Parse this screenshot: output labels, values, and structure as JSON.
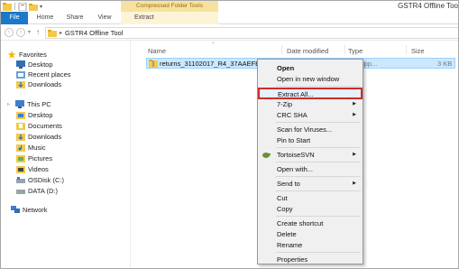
{
  "window": {
    "title": "GSTR4 Offline Too",
    "context_band": "Compressed Folder Tools"
  },
  "ribbon": {
    "tabs": [
      "File",
      "Home",
      "Share",
      "View",
      "Extract"
    ]
  },
  "address": {
    "crumb": "GSTR4 Offline Tool"
  },
  "nav": {
    "favorites": "Favorites",
    "fav_items": [
      "Desktop",
      "Recent places",
      "Downloads"
    ],
    "this_pc": "This PC",
    "pc_items": [
      "Desktop",
      "Documents",
      "Downloads",
      "Music",
      "Pictures",
      "Videos",
      "OSDisk (C:)",
      "DATA (D:)"
    ],
    "network": "Network"
  },
  "columns": {
    "name": "Name",
    "date": "Date modified",
    "type": "Type",
    "size": "Size"
  },
  "file": {
    "name": "returns_31102017_R4_37AAEFB0727D",
    "type": "pressed (zipp...",
    "size": "3 KB"
  },
  "context_menu": {
    "items": [
      {
        "label": "Open",
        "bold": true
      },
      {
        "label": "Open in new window"
      },
      {
        "label": "Extract All...",
        "highlighted": true
      },
      {
        "label": "7-Zip",
        "submenu": true
      },
      {
        "label": "CRC SHA",
        "submenu": true
      },
      {
        "label": "Scan for Viruses..."
      },
      {
        "label": "Pin to Start"
      },
      {
        "label": "TortoiseSVN",
        "submenu": true,
        "icon": "tortoise-svn-icon"
      },
      {
        "label": "Open with..."
      },
      {
        "label": "Send to",
        "submenu": true
      },
      {
        "label": "Cut"
      },
      {
        "label": "Copy"
      },
      {
        "label": "Create shortcut"
      },
      {
        "label": "Delete"
      },
      {
        "label": "Rename"
      },
      {
        "label": "Properties"
      }
    ]
  },
  "colors": {
    "file_tab": "#1979ca",
    "context_band": "#f6e2a0",
    "selection": "#cce8ff",
    "highlight_border": "#d12a2a"
  }
}
